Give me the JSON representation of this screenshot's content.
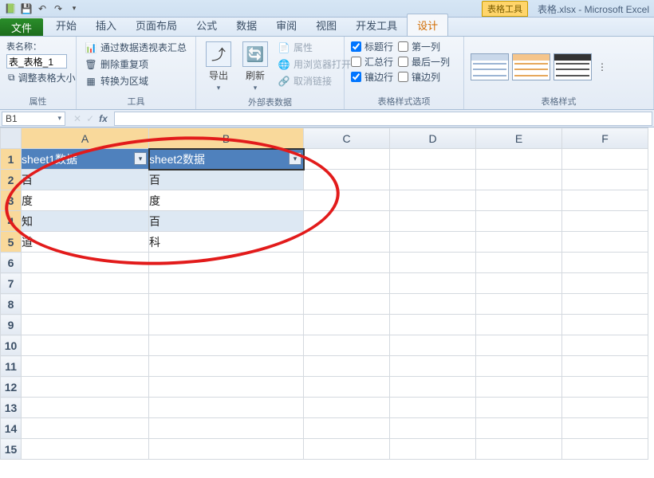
{
  "titlebar": {
    "tooltab": "表格工具",
    "doc": "表格.xlsx - Microsoft Excel"
  },
  "tabs": {
    "file": "文件",
    "items": [
      "开始",
      "插入",
      "页面布局",
      "公式",
      "数据",
      "审阅",
      "视图",
      "开发工具",
      "设计"
    ],
    "active": "设计"
  },
  "ribbon": {
    "name_group": {
      "label": "表名称：",
      "value": "表_表格_1",
      "resize": "调整表格大小",
      "title": "属性"
    },
    "tools_group": {
      "pivot": "通过数据透视表汇总",
      "dedup": "删除重复项",
      "convert": "转换为区域",
      "title": "工具"
    },
    "export_group": {
      "export": "导出",
      "refresh": "刷新",
      "props": "属性",
      "browser": "用浏览器打开",
      "unlink": "取消链接",
      "title": "外部表数据"
    },
    "options_group": {
      "header_row": "标题行",
      "first_col": "第一列",
      "total_row": "汇总行",
      "last_col": "最后一列",
      "banded_row": "镶边行",
      "banded_col": "镶边列",
      "title": "表格样式选项"
    },
    "styles_group": {
      "title": "表格样式"
    }
  },
  "formula_bar": {
    "name_box": "B1",
    "formula": ""
  },
  "columns": [
    "A",
    "B",
    "C",
    "D",
    "E",
    "F"
  ],
  "table": {
    "headers": {
      "A": "sheet1数据",
      "B": "sheet2数据"
    },
    "rows": [
      {
        "A": "百",
        "B": "百"
      },
      {
        "A": "度",
        "B": "度"
      },
      {
        "A": "知",
        "B": "百"
      },
      {
        "A": "道",
        "B": "科"
      }
    ]
  },
  "checked": {
    "header_row": true,
    "total_row": false,
    "banded_row": true,
    "first_col": false,
    "last_col": false,
    "banded_col": false
  }
}
